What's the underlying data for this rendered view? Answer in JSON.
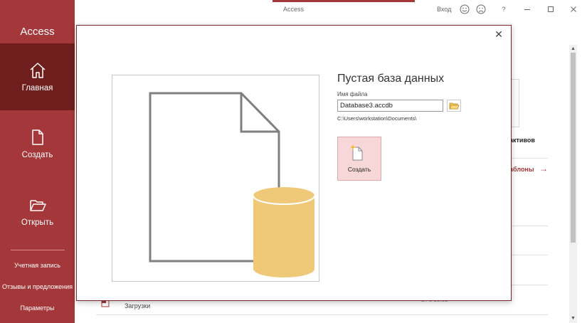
{
  "app": {
    "name": "Access",
    "window_title": "Access",
    "sign_in": "Вход"
  },
  "sidebar": {
    "items": [
      {
        "label": "Главная",
        "icon": "home-icon"
      },
      {
        "label": "Создать",
        "icon": "new-document-icon"
      },
      {
        "label": "Открыть",
        "icon": "open-folder-icon"
      }
    ],
    "bottom": [
      {
        "label": "Учетная запись"
      },
      {
        "label": "Отзывы и предложения"
      },
      {
        "label": "Параметры"
      }
    ]
  },
  "titlebar": {
    "buttons": [
      "smiley-icon",
      "frown-icon",
      "help-icon",
      "minimize-icon",
      "maximize-icon",
      "close-icon"
    ],
    "help": "?"
  },
  "background": {
    "template_card_label": "активов",
    "templates_link": "аблоны",
    "downloads_label": "Загрузки",
    "time": "Вт в 10:02"
  },
  "dialog": {
    "title": "Пустая база данных",
    "file_name_label": "Имя файла",
    "file_name_value": "Database3.accdb",
    "path": "C:\\Users\\workstation\\Documents\\",
    "create_label": "Создать"
  },
  "colors": {
    "accent": "#a4373a",
    "accent_dark": "#6e1e1c",
    "create_bg": "#f8d7d9",
    "database_fill": "#f0c978"
  }
}
